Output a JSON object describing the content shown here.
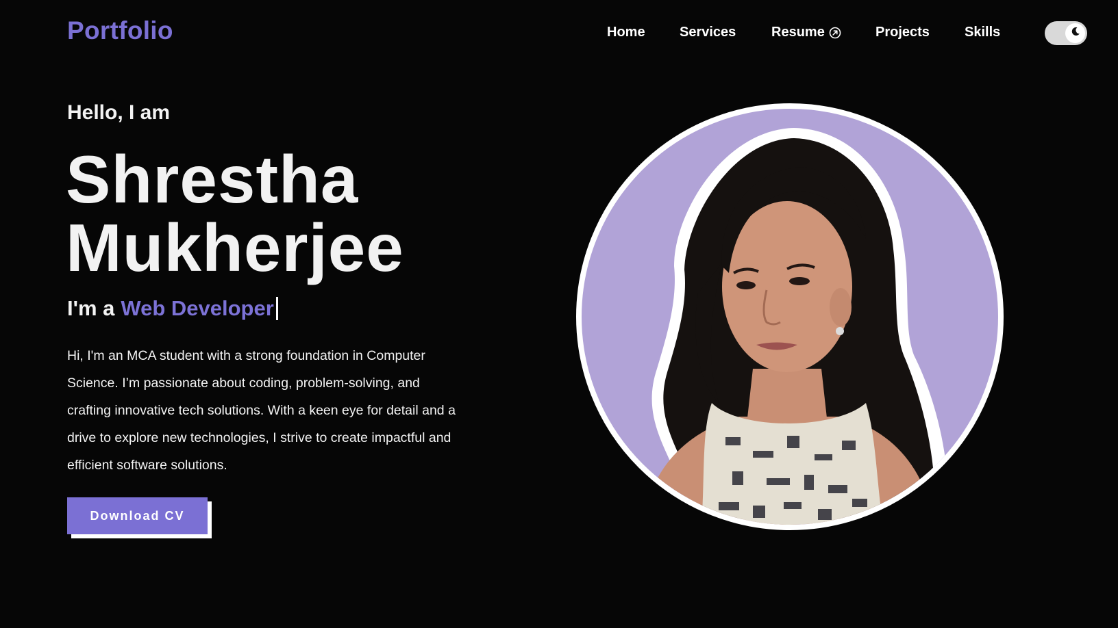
{
  "nav": {
    "logo": "Portfolio",
    "links": {
      "home": "Home",
      "services": "Services",
      "resume": "Resume",
      "projects": "Projects",
      "skills": "Skills"
    },
    "resume_icon": "arrow-up-right-circle-icon",
    "theme_toggle_icon": "moon-icon"
  },
  "hero": {
    "greeting": "Hello, I am",
    "name_line1": "Shrestha",
    "name_line2": "Mukherjee",
    "role_prefix": "I'm a",
    "role_highlight": "Web Developer",
    "bio": "Hi, I'm an MCA student with a strong foundation in Computer Science. I’m passionate about coding, problem-solving, and crafting innovative tech solutions. With a keen eye for detail and a drive to explore new technologies, I strive to create impactful and efficient software solutions.",
    "cta": "Download CV"
  },
  "colors": {
    "background": "#060606",
    "accent": "#7b70d4",
    "portrait_background": "#b1a3d7",
    "text": "#f3f3f3"
  }
}
